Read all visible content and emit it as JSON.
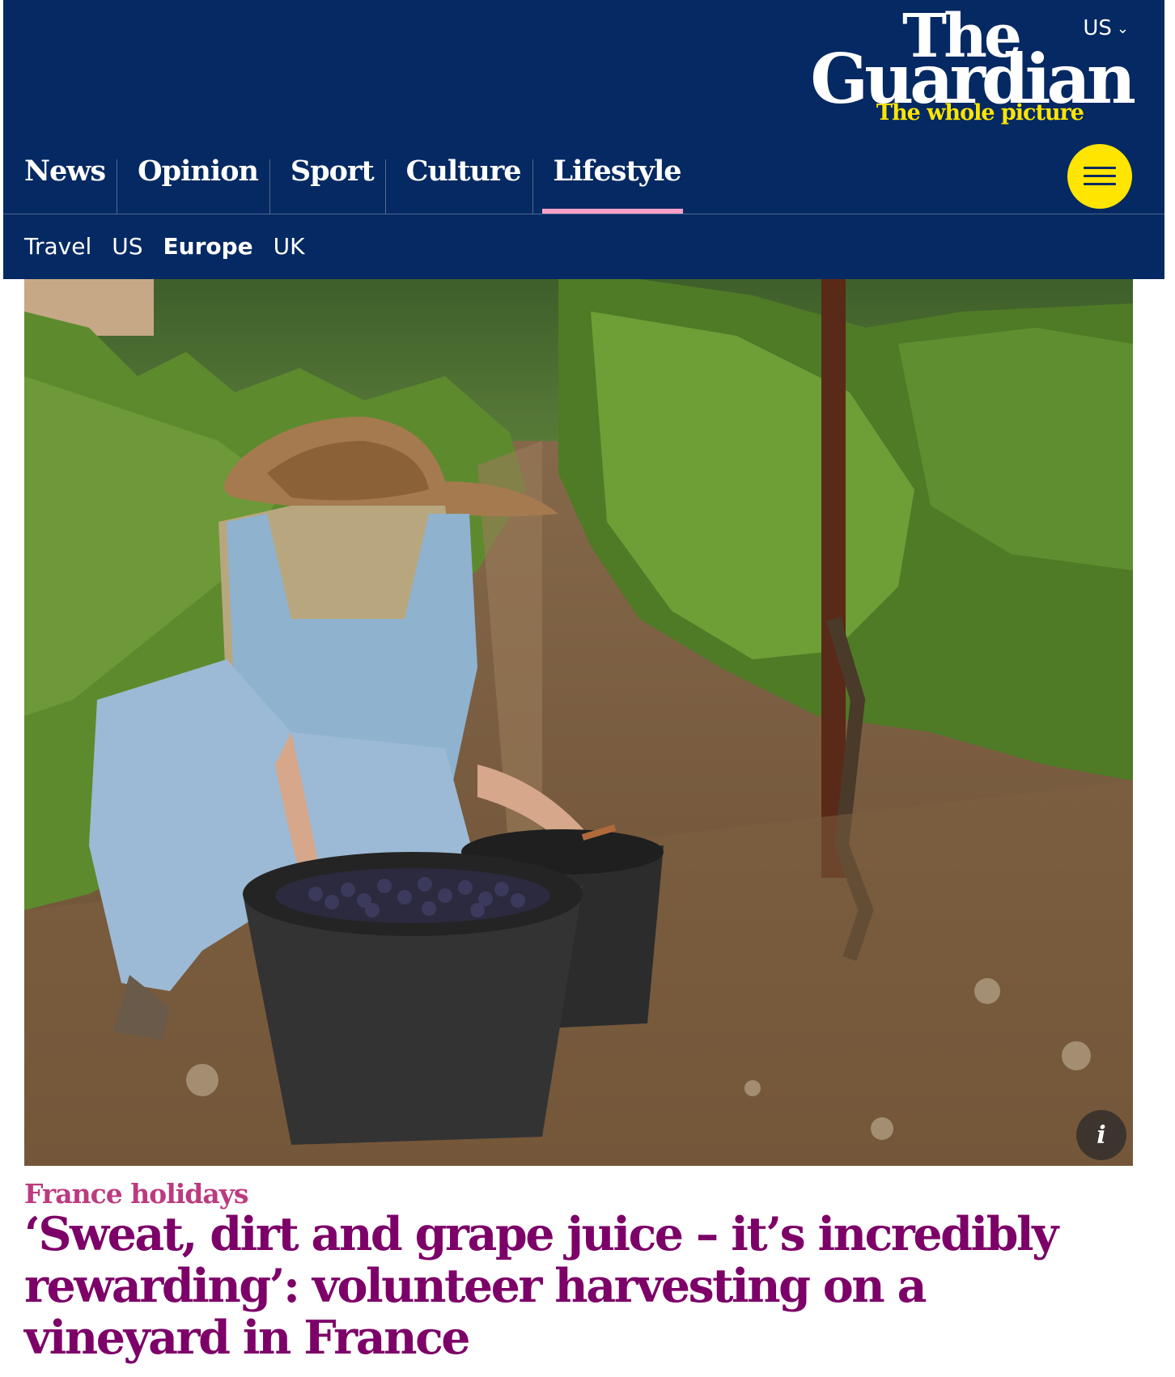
{
  "header": {
    "edition": "US",
    "logo": {
      "line1": "The",
      "line2": "Guardian",
      "tagline": "The whole picture"
    }
  },
  "nav": {
    "pillars": [
      {
        "label": "News"
      },
      {
        "label": "Opinion"
      },
      {
        "label": "Sport"
      },
      {
        "label": "Culture"
      },
      {
        "label": "Lifestyle",
        "active": true
      }
    ],
    "subnav": [
      {
        "label": "Travel"
      },
      {
        "label": "US"
      },
      {
        "label": "Europe",
        "current": true
      },
      {
        "label": "UK"
      }
    ]
  },
  "article": {
    "kicker": "France holidays",
    "headline": "‘Sweat, dirt and grape juice – it’s incredibly rewarding’: volunteer harvesting on a vineyard in France",
    "image_info_glyph": "i"
  },
  "colors": {
    "brand_navy": "#052962",
    "brand_yellow": "#ffe500",
    "lifestyle_pink": "#f9a0c9",
    "kicker_pink": "#bb3b80",
    "headline_purple": "#7d0068"
  }
}
